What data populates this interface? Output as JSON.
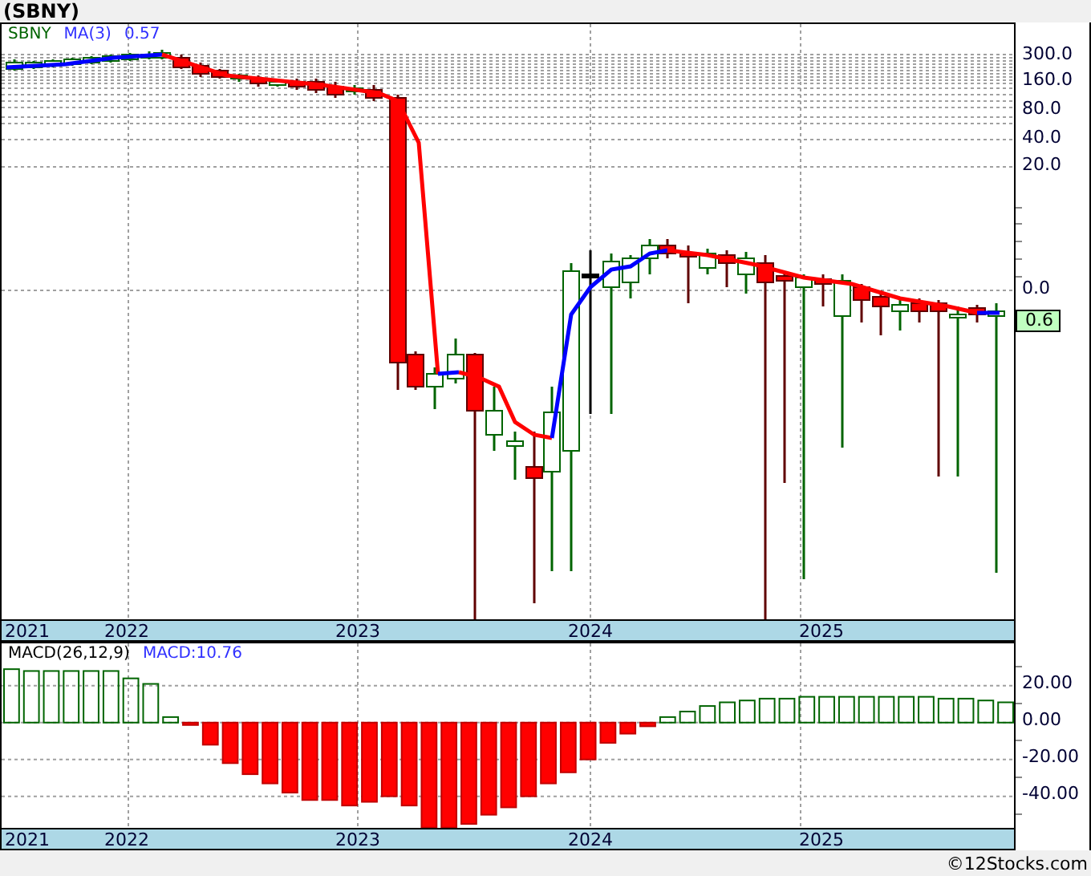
{
  "title": "(SBNY)",
  "price_panel": {
    "legend": {
      "symbol": "SBNY",
      "indicator": "MA(3)",
      "value": "0.57"
    },
    "axis_labels": [
      "300.0",
      "160.0",
      "80.0",
      "40.0",
      "20.0",
      "0.0"
    ],
    "last_price": "0.6"
  },
  "date_axis": [
    "2021",
    "2022",
    "2023",
    "2024",
    "2025"
  ],
  "macd_panel": {
    "label": "MACD(26,12,9)",
    "reading": "MACD:10.76",
    "chart_data": {
      "type": "bar",
      "grid": true,
      "ylim": [
        -58,
        43
      ],
      "yticks": [
        {
          "value": 20,
          "label": "20.00"
        },
        {
          "value": 0,
          "label": "0.00"
        },
        {
          "value": -20,
          "label": "-20.00"
        },
        {
          "value": -40,
          "label": "-40.00"
        }
      ],
      "values": [
        29,
        28,
        28,
        28,
        28,
        28,
        24,
        21,
        3,
        -1,
        -12,
        -22,
        -28,
        -33,
        -38,
        -42,
        -42,
        -45,
        -43,
        -40,
        -45,
        -57,
        -57,
        -55,
        -50,
        -46,
        -40,
        -33,
        -27,
        -20,
        -11,
        -6,
        -2,
        3,
        6,
        9,
        11,
        12,
        13,
        13,
        14,
        14,
        14,
        14,
        14,
        14,
        14,
        13,
        13,
        12,
        11
      ]
    }
  },
  "macd_date_axis": [
    "2021",
    "2022",
    "2023",
    "2024",
    "2025"
  ],
  "footer": "©12Stocks.com"
}
